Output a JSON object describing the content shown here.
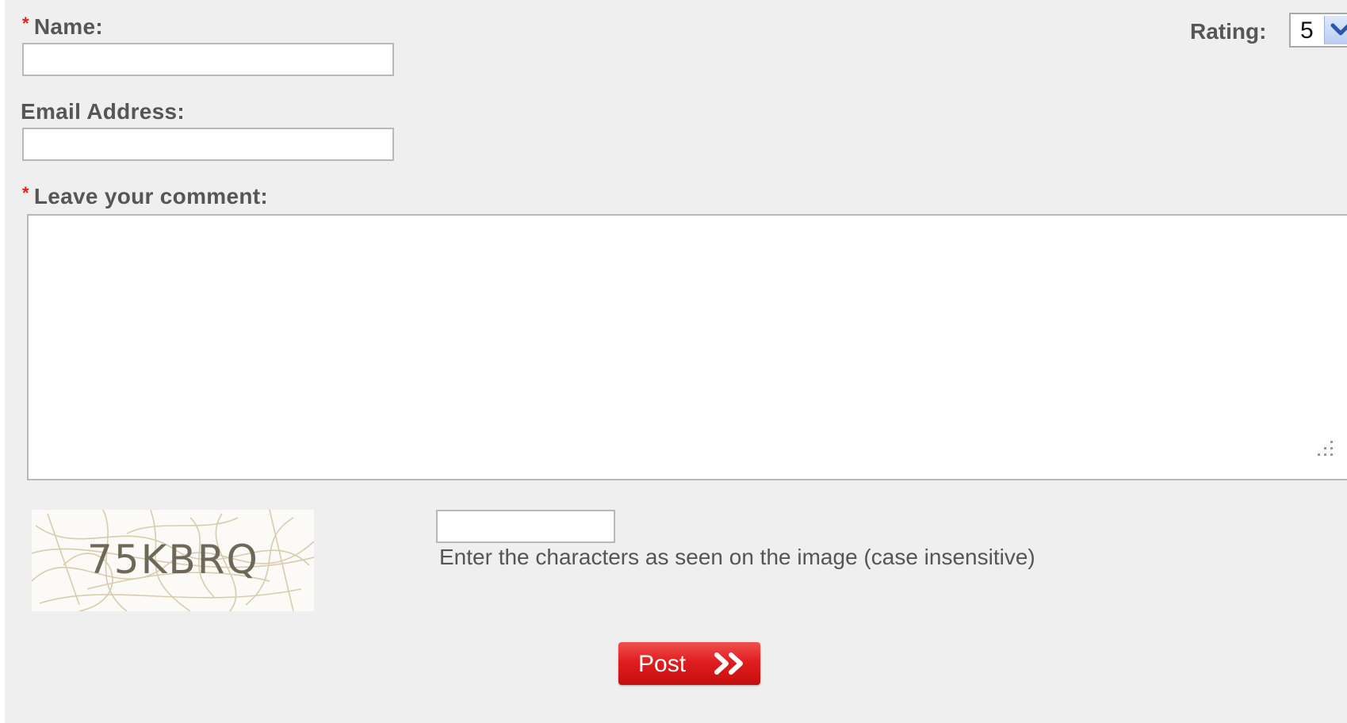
{
  "form": {
    "name": {
      "required_marker": "*",
      "label": "Name:",
      "value": ""
    },
    "email": {
      "label": "Email Address:",
      "value": ""
    },
    "comment": {
      "required_marker": "*",
      "label": "Leave your comment:",
      "value": ""
    },
    "rating": {
      "label": "Rating:",
      "selected": "5"
    },
    "captcha": {
      "image_text": "75KBRQ",
      "value": "",
      "hint": "Enter the characters as seen on the image (case insensitive)"
    },
    "submit": {
      "label": "Post"
    }
  },
  "colors": {
    "background": "#efefef",
    "label": "#565656",
    "required": "#e02020",
    "button": "#e01e1e"
  },
  "icons": {
    "rating_arrow": "chevron-down-icon",
    "submit_arrow": "double-chevron-right-icon",
    "resize": "resize-grip-icon"
  }
}
